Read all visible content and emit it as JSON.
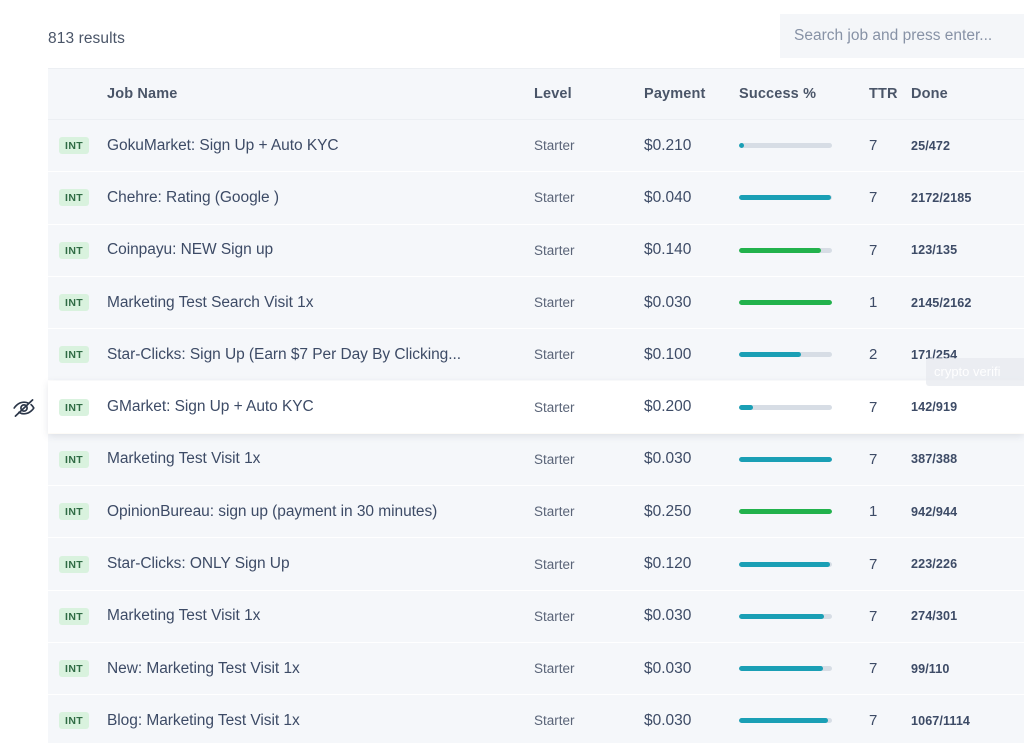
{
  "header": {
    "results_text": "813 results",
    "search_placeholder": "Search job and press enter...",
    "search_value": ""
  },
  "table": {
    "columns": {
      "badge": "",
      "job_name": "Job Name",
      "level": "Level",
      "payment": "Payment",
      "success": "Success %",
      "ttr": "TTR",
      "done": "Done"
    },
    "rows": [
      {
        "badge": "INT",
        "job_name": "GokuMarket: Sign Up + Auto KYC",
        "level": "Starter",
        "payment": "$0.210",
        "success_pct": 5,
        "bar_color": "#1a9fb5",
        "ttr": "7",
        "done": "25/472",
        "hovered": false
      },
      {
        "badge": "INT",
        "job_name": "Chehre: Rating (Google )",
        "level": "Starter",
        "payment": "$0.040",
        "success_pct": 99,
        "bar_color": "#1a9fb5",
        "ttr": "7",
        "done": "2172/2185",
        "hovered": false
      },
      {
        "badge": "INT",
        "job_name": "Coinpayu: NEW Sign up",
        "level": "Starter",
        "payment": "$0.140",
        "success_pct": 88,
        "bar_color": "#22b24c",
        "ttr": "7",
        "done": "123/135",
        "hovered": false
      },
      {
        "badge": "INT",
        "job_name": "Marketing Test Search Visit 1x",
        "level": "Starter",
        "payment": "$0.030",
        "success_pct": 100,
        "bar_color": "#22b24c",
        "ttr": "1",
        "done": "2145/2162",
        "hovered": false
      },
      {
        "badge": "INT",
        "job_name": "Star-Clicks: Sign Up (Earn $7 Per Day By Clicking...",
        "level": "Starter",
        "payment": "$0.100",
        "success_pct": 67,
        "bar_color": "#1a9fb5",
        "ttr": "2",
        "done": "171/254",
        "hovered": false
      },
      {
        "badge": "INT",
        "job_name": "GMarket: Sign Up + Auto KYC",
        "level": "Starter",
        "payment": "$0.200",
        "success_pct": 15,
        "bar_color": "#1a9fb5",
        "ttr": "7",
        "done": "142/919",
        "hovered": true
      },
      {
        "badge": "INT",
        "job_name": "Marketing Test Visit 1x",
        "level": "Starter",
        "payment": "$0.030",
        "success_pct": 100,
        "bar_color": "#1a9fb5",
        "ttr": "7",
        "done": "387/388",
        "hovered": false
      },
      {
        "badge": "INT",
        "job_name": "OpinionBureau: sign up (payment in 30 minutes)",
        "level": "Starter",
        "payment": "$0.250",
        "success_pct": 100,
        "bar_color": "#22b24c",
        "ttr": "1",
        "done": "942/944",
        "hovered": false
      },
      {
        "badge": "INT",
        "job_name": "Star-Clicks: ONLY Sign Up",
        "level": "Starter",
        "payment": "$0.120",
        "success_pct": 98,
        "bar_color": "#1a9fb5",
        "ttr": "7",
        "done": "223/226",
        "hovered": false
      },
      {
        "badge": "INT",
        "job_name": "Marketing Test Visit 1x",
        "level": "Starter",
        "payment": "$0.030",
        "success_pct": 91,
        "bar_color": "#1a9fb5",
        "ttr": "7",
        "done": "274/301",
        "hovered": false
      },
      {
        "badge": "INT",
        "job_name": "New: Marketing Test Visit 1x",
        "level": "Starter",
        "payment": "$0.030",
        "success_pct": 90,
        "bar_color": "#1a9fb5",
        "ttr": "7",
        "done": "99/110",
        "hovered": false
      },
      {
        "badge": "INT",
        "job_name": "Blog: Marketing Test Visit 1x",
        "level": "Starter",
        "payment": "$0.030",
        "success_pct": 96,
        "bar_color": "#1a9fb5",
        "ttr": "7",
        "done": "1067/1114",
        "hovered": false
      }
    ]
  },
  "overlays": {
    "hide_icon": "eye-off-icon",
    "ghost_tooltip": "crypto verifi"
  },
  "colors": {
    "bar_teal": "#1a9fb5",
    "bar_green": "#22b24c",
    "bar_track": "#d7dde5",
    "row_bg": "#f5f7fa",
    "badge_bg": "#d9f2de",
    "badge_text": "#2f6b44",
    "text": "#3d4b66"
  }
}
